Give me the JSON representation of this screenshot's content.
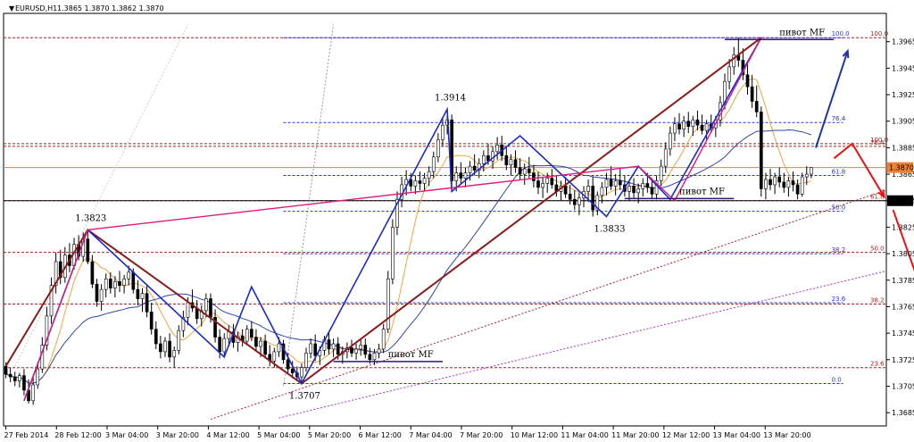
{
  "chart_data": {
    "type": "candlestick",
    "title": "EURUSD,H1  1.3865 1.3870 1.3862 1.3870",
    "symbol": "EURUSD,H1",
    "ohlc_header": "1.3865 1.3870 1.3862 1.3870",
    "ylim": [
      1.3675,
      1.3985
    ],
    "y_ticks": [
      "1.3965",
      "1.3945",
      "1.3925",
      "1.3905",
      "1.3885",
      "1.3865",
      "1.3845",
      "1.3825",
      "1.3805",
      "1.3785",
      "1.3765",
      "1.3745",
      "1.3725",
      "1.3705",
      "1.3685"
    ],
    "x_ticks": [
      "27 Feb 2014",
      "28 Feb 12:00",
      "3 Mar 04:00",
      "3 Mar 20:00",
      "4 Mar 12:00",
      "5 Mar 04:00",
      "5 Mar 20:00",
      "6 Mar 12:00",
      "7 Mar 04:00",
      "7 Mar 20:00",
      "10 Mar 12:00",
      "11 Mar 04:00",
      "11 Mar 20:00",
      "12 Mar 12:00",
      "13 Mar 04:00",
      "13 Mar 20:00"
    ],
    "current_price": {
      "value": 1.387,
      "label": "1.3870"
    },
    "marked_price": {
      "value": 1.3845,
      "label": "1.3845"
    },
    "swing_labels": [
      {
        "text": "1.3823",
        "price": 1.3823,
        "bar": 18
      },
      {
        "text": "1.3914",
        "price": 1.3914,
        "bar": 97
      },
      {
        "text": "1.3707",
        "price": 1.3707,
        "bar": 65
      },
      {
        "text": "1.3833",
        "price": 1.3833,
        "bar": 132
      }
    ],
    "pivot_labels": [
      {
        "text": "пивот MF",
        "price": 1.397,
        "bar": 170
      },
      {
        "text": "пивот MF",
        "price": 1.385,
        "bar": 148
      },
      {
        "text": "пивот MF",
        "price": 1.3727,
        "bar": 84
      }
    ],
    "fib_blue": [
      {
        "label": "100.0",
        "price": 1.3968
      },
      {
        "label": "76.4",
        "price": 1.3904
      },
      {
        "label": "61.8",
        "price": 1.3864
      },
      {
        "label": "50.0",
        "price": 1.3837
      },
      {
        "label": "38.2",
        "price": 1.3805
      },
      {
        "label": "23.6",
        "price": 1.3768
      },
      {
        "label": "0.0",
        "price": 1.3707
      }
    ],
    "fib_red": [
      {
        "label": "100.0",
        "price": 1.3968
      },
      {
        "label": "100.0",
        "price": 1.3888
      },
      {
        "label": "76.4",
        "price": 1.3886
      },
      {
        "label": "61.8",
        "price": 1.3845
      },
      {
        "label": "50.0",
        "price": 1.3806
      },
      {
        "label": "38.2",
        "price": 1.3767
      },
      {
        "label": "23.6",
        "price": 1.3719
      }
    ],
    "bars": [
      [
        1.372,
        1.3723,
        1.3711,
        1.3714
      ],
      [
        1.3714,
        1.3719,
        1.3708,
        1.3712
      ],
      [
        1.3712,
        1.3716,
        1.3705,
        1.3709
      ],
      [
        1.3709,
        1.3715,
        1.3704,
        1.3713
      ],
      [
        1.3713,
        1.3718,
        1.3698,
        1.3702
      ],
      [
        1.3702,
        1.371,
        1.3692,
        1.3694
      ],
      [
        1.3694,
        1.3712,
        1.3691,
        1.3706
      ],
      [
        1.3706,
        1.3723,
        1.3703,
        1.3718
      ],
      [
        1.3718,
        1.3742,
        1.3715,
        1.3736
      ],
      [
        1.3736,
        1.3765,
        1.3732,
        1.3758
      ],
      [
        1.3758,
        1.3787,
        1.3752,
        1.3781
      ],
      [
        1.3781,
        1.3806,
        1.3775,
        1.3799
      ],
      [
        1.3799,
        1.3808,
        1.3782,
        1.3787
      ],
      [
        1.3787,
        1.381,
        1.3783,
        1.3804
      ],
      [
        1.3804,
        1.3813,
        1.3791,
        1.3796
      ],
      [
        1.3796,
        1.3817,
        1.3793,
        1.3812
      ],
      [
        1.3812,
        1.3819,
        1.38,
        1.3803
      ],
      [
        1.3803,
        1.3821,
        1.3799,
        1.3816
      ],
      [
        1.3816,
        1.3823,
        1.3797,
        1.3799
      ],
      [
        1.3799,
        1.3804,
        1.3779,
        1.3782
      ],
      [
        1.3782,
        1.3786,
        1.3765,
        1.3769
      ],
      [
        1.3769,
        1.3782,
        1.3762,
        1.3778
      ],
      [
        1.3778,
        1.379,
        1.3772,
        1.3786
      ],
      [
        1.3786,
        1.3791,
        1.3775,
        1.3779
      ],
      [
        1.3779,
        1.3788,
        1.3772,
        1.3784
      ],
      [
        1.3784,
        1.3792,
        1.3776,
        1.3781
      ],
      [
        1.3781,
        1.3789,
        1.3775,
        1.3786
      ],
      [
        1.3786,
        1.3796,
        1.3781,
        1.3791
      ],
      [
        1.3791,
        1.3794,
        1.3775,
        1.3778
      ],
      [
        1.3778,
        1.3785,
        1.3766,
        1.3771
      ],
      [
        1.3771,
        1.3779,
        1.3761,
        1.3775
      ],
      [
        1.3775,
        1.3781,
        1.3757,
        1.3761
      ],
      [
        1.3761,
        1.3768,
        1.3744,
        1.3748
      ],
      [
        1.3748,
        1.3754,
        1.3733,
        1.3737
      ],
      [
        1.3737,
        1.3743,
        1.3726,
        1.3731
      ],
      [
        1.3731,
        1.3742,
        1.3727,
        1.3739
      ],
      [
        1.3739,
        1.3745,
        1.3723,
        1.3727
      ],
      [
        1.3727,
        1.3735,
        1.3719,
        1.3732
      ],
      [
        1.3732,
        1.3751,
        1.3729,
        1.3747
      ],
      [
        1.3747,
        1.3762,
        1.3742,
        1.3757
      ],
      [
        1.3757,
        1.3772,
        1.3751,
        1.3768
      ],
      [
        1.3768,
        1.3778,
        1.3761,
        1.3764
      ],
      [
        1.3764,
        1.377,
        1.3752,
        1.3756
      ],
      [
        1.3756,
        1.3766,
        1.375,
        1.3762
      ],
      [
        1.3762,
        1.3775,
        1.3757,
        1.3771
      ],
      [
        1.3771,
        1.3775,
        1.3753,
        1.3757
      ],
      [
        1.3757,
        1.3763,
        1.3738,
        1.3742
      ],
      [
        1.3742,
        1.3748,
        1.3726,
        1.3731
      ],
      [
        1.3731,
        1.3745,
        1.3727,
        1.3741
      ],
      [
        1.3741,
        1.3751,
        1.3735,
        1.3746
      ],
      [
        1.3746,
        1.3752,
        1.3734,
        1.3738
      ],
      [
        1.3738,
        1.3746,
        1.3731,
        1.3743
      ],
      [
        1.3743,
        1.3748,
        1.3735,
        1.3739
      ],
      [
        1.3739,
        1.3751,
        1.3736,
        1.3748
      ],
      [
        1.3748,
        1.3754,
        1.3739,
        1.3742
      ],
      [
        1.3742,
        1.3748,
        1.3731,
        1.3735
      ],
      [
        1.3735,
        1.3742,
        1.3727,
        1.3739
      ],
      [
        1.3739,
        1.3744,
        1.3726,
        1.3729
      ],
      [
        1.3729,
        1.3736,
        1.372,
        1.3724
      ],
      [
        1.3724,
        1.3734,
        1.3719,
        1.3731
      ],
      [
        1.3731,
        1.3742,
        1.3727,
        1.3737
      ],
      [
        1.3737,
        1.374,
        1.3722,
        1.3725
      ],
      [
        1.3725,
        1.373,
        1.3714,
        1.3718
      ],
      [
        1.3718,
        1.3724,
        1.3711,
        1.3715
      ],
      [
        1.3715,
        1.372,
        1.3709,
        1.3712
      ],
      [
        1.3712,
        1.3722,
        1.3707,
        1.3719
      ],
      [
        1.3719,
        1.3734,
        1.3716,
        1.373
      ],
      [
        1.373,
        1.3741,
        1.3726,
        1.3737
      ],
      [
        1.3737,
        1.3744,
        1.3724,
        1.3728
      ],
      [
        1.3728,
        1.3735,
        1.3721,
        1.3732
      ],
      [
        1.3732,
        1.3743,
        1.3728,
        1.374
      ],
      [
        1.374,
        1.3745,
        1.3729,
        1.3733
      ],
      [
        1.3733,
        1.3741,
        1.3727,
        1.3737
      ],
      [
        1.3737,
        1.3742,
        1.3725,
        1.3729
      ],
      [
        1.3729,
        1.3735,
        1.3722,
        1.3731
      ],
      [
        1.3731,
        1.3738,
        1.3726,
        1.3734
      ],
      [
        1.3734,
        1.374,
        1.3727,
        1.373
      ],
      [
        1.373,
        1.3737,
        1.3725,
        1.3733
      ],
      [
        1.3733,
        1.374,
        1.3728,
        1.3736
      ],
      [
        1.3736,
        1.3741,
        1.3726,
        1.3729
      ],
      [
        1.3729,
        1.3734,
        1.3722,
        1.3725
      ],
      [
        1.3725,
        1.3733,
        1.3721,
        1.373
      ],
      [
        1.373,
        1.3737,
        1.3726,
        1.3733
      ],
      [
        1.3733,
        1.3752,
        1.373,
        1.3748
      ],
      [
        1.3748,
        1.3792,
        1.3745,
        1.3786
      ],
      [
        1.3786,
        1.3831,
        1.3782,
        1.3825
      ],
      [
        1.3825,
        1.3852,
        1.3819,
        1.3846
      ],
      [
        1.3846,
        1.3863,
        1.384,
        1.3857
      ],
      [
        1.3857,
        1.3868,
        1.3849,
        1.3861
      ],
      [
        1.3861,
        1.3866,
        1.3852,
        1.3856
      ],
      [
        1.3856,
        1.3864,
        1.385,
        1.386
      ],
      [
        1.386,
        1.3867,
        1.3853,
        1.3858
      ],
      [
        1.3858,
        1.3866,
        1.3852,
        1.3862
      ],
      [
        1.3862,
        1.3871,
        1.3856,
        1.3867
      ],
      [
        1.3867,
        1.3882,
        1.3862,
        1.3878
      ],
      [
        1.3878,
        1.3896,
        1.3874,
        1.3891
      ],
      [
        1.3891,
        1.3908,
        1.3886,
        1.3902
      ],
      [
        1.3902,
        1.3914,
        1.3895,
        1.3906
      ],
      [
        1.3906,
        1.391,
        1.3855,
        1.386
      ],
      [
        1.386,
        1.3871,
        1.3852,
        1.3866
      ],
      [
        1.3866,
        1.3874,
        1.3858,
        1.3862
      ],
      [
        1.3862,
        1.387,
        1.3855,
        1.3866
      ],
      [
        1.3866,
        1.3875,
        1.386,
        1.3871
      ],
      [
        1.3871,
        1.388,
        1.3864,
        1.3868
      ],
      [
        1.3868,
        1.3877,
        1.3862,
        1.3873
      ],
      [
        1.3873,
        1.3883,
        1.3867,
        1.3879
      ],
      [
        1.3879,
        1.3888,
        1.3872,
        1.3875
      ],
      [
        1.3875,
        1.3886,
        1.3869,
        1.3882
      ],
      [
        1.3882,
        1.3893,
        1.3876,
        1.3887
      ],
      [
        1.3887,
        1.3894,
        1.3875,
        1.3879
      ],
      [
        1.3879,
        1.3886,
        1.3868,
        1.3872
      ],
      [
        1.3872,
        1.388,
        1.3864,
        1.3876
      ],
      [
        1.3876,
        1.3883,
        1.3866,
        1.387
      ],
      [
        1.387,
        1.3877,
        1.3861,
        1.3865
      ],
      [
        1.3865,
        1.3873,
        1.3857,
        1.3869
      ],
      [
        1.3869,
        1.3878,
        1.3862,
        1.3866
      ],
      [
        1.3866,
        1.3872,
        1.3855,
        1.386
      ],
      [
        1.386,
        1.3867,
        1.385,
        1.3855
      ],
      [
        1.3855,
        1.3863,
        1.3847,
        1.3858
      ],
      [
        1.3858,
        1.3866,
        1.3851,
        1.3862
      ],
      [
        1.3862,
        1.3869,
        1.3854,
        1.3857
      ],
      [
        1.3857,
        1.3864,
        1.3848,
        1.3852
      ],
      [
        1.3852,
        1.386,
        1.3845,
        1.3856
      ],
      [
        1.3856,
        1.3863,
        1.3847,
        1.385
      ],
      [
        1.385,
        1.3857,
        1.3842,
        1.3846
      ],
      [
        1.3846,
        1.3853,
        1.3838,
        1.3842
      ],
      [
        1.3842,
        1.3851,
        1.3834,
        1.3847
      ],
      [
        1.3847,
        1.3856,
        1.384,
        1.3852
      ],
      [
        1.3852,
        1.3861,
        1.3844,
        1.3856
      ],
      [
        1.3856,
        1.3863,
        1.3833,
        1.3838
      ],
      [
        1.3838,
        1.3852,
        1.3834,
        1.3849
      ],
      [
        1.3849,
        1.3859,
        1.3843,
        1.3855
      ],
      [
        1.3855,
        1.3866,
        1.3849,
        1.3861
      ],
      [
        1.3861,
        1.3871,
        1.3853,
        1.3856
      ],
      [
        1.3856,
        1.3865,
        1.3849,
        1.386
      ],
      [
        1.386,
        1.3869,
        1.3853,
        1.3857
      ],
      [
        1.3857,
        1.3864,
        1.3848,
        1.3852
      ],
      [
        1.3852,
        1.386,
        1.3845,
        1.3856
      ],
      [
        1.3856,
        1.3862,
        1.3847,
        1.3851
      ],
      [
        1.3851,
        1.3858,
        1.3843,
        1.3854
      ],
      [
        1.3854,
        1.3862,
        1.3848,
        1.3858
      ],
      [
        1.3858,
        1.3866,
        1.3851,
        1.3855
      ],
      [
        1.3855,
        1.3862,
        1.3847,
        1.385
      ],
      [
        1.385,
        1.3864,
        1.3846,
        1.386
      ],
      [
        1.386,
        1.3876,
        1.3856,
        1.3871
      ],
      [
        1.3871,
        1.3889,
        1.3866,
        1.3884
      ],
      [
        1.3884,
        1.3901,
        1.3879,
        1.3896
      ],
      [
        1.3896,
        1.3908,
        1.389,
        1.3903
      ],
      [
        1.3903,
        1.3911,
        1.3895,
        1.3899
      ],
      [
        1.3899,
        1.3909,
        1.3893,
        1.3905
      ],
      [
        1.3905,
        1.3912,
        1.3896,
        1.3901
      ],
      [
        1.3901,
        1.3909,
        1.3894,
        1.3906
      ],
      [
        1.3906,
        1.3913,
        1.3898,
        1.3902
      ],
      [
        1.3902,
        1.391,
        1.3895,
        1.3898
      ],
      [
        1.3898,
        1.3906,
        1.3891,
        1.3903
      ],
      [
        1.3903,
        1.391,
        1.3896,
        1.39
      ],
      [
        1.39,
        1.3909,
        1.3893,
        1.3906
      ],
      [
        1.3906,
        1.3924,
        1.3901,
        1.3919
      ],
      [
        1.3919,
        1.3941,
        1.3914,
        1.3935
      ],
      [
        1.3935,
        1.3952,
        1.3929,
        1.3946
      ],
      [
        1.3946,
        1.3961,
        1.394,
        1.3955
      ],
      [
        1.3955,
        1.3968,
        1.3946,
        1.3951
      ],
      [
        1.3951,
        1.396,
        1.3936,
        1.394
      ],
      [
        1.394,
        1.395,
        1.3925,
        1.3931
      ],
      [
        1.3931,
        1.394,
        1.3915,
        1.392
      ],
      [
        1.392,
        1.3932,
        1.3908,
        1.3912
      ],
      [
        1.3912,
        1.3916,
        1.3848,
        1.3854
      ],
      [
        1.3854,
        1.3866,
        1.3846,
        1.3861
      ],
      [
        1.3861,
        1.3869,
        1.3853,
        1.3857
      ],
      [
        1.3857,
        1.3866,
        1.385,
        1.3863
      ],
      [
        1.3863,
        1.387,
        1.3855,
        1.3859
      ],
      [
        1.3859,
        1.3866,
        1.3851,
        1.3855
      ],
      [
        1.3855,
        1.3863,
        1.3848,
        1.386
      ],
      [
        1.386,
        1.3867,
        1.3852,
        1.3857
      ],
      [
        1.3857,
        1.3861,
        1.3846,
        1.385
      ],
      [
        1.385,
        1.3866,
        1.3848,
        1.3863
      ],
      [
        1.3863,
        1.3871,
        1.3857,
        1.3865
      ],
      [
        1.3865,
        1.387,
        1.3862,
        1.387
      ]
    ],
    "zigzag_blue": [
      [
        4,
        1.3694
      ],
      [
        18,
        1.3823
      ],
      [
        48,
        1.3727
      ],
      [
        54,
        1.378
      ],
      [
        65,
        1.3707
      ],
      [
        97,
        1.3914
      ],
      [
        98,
        1.3852
      ],
      [
        113,
        1.3894
      ],
      [
        132,
        1.3833
      ],
      [
        139,
        1.3871
      ],
      [
        146,
        1.3846
      ],
      [
        166,
        1.3968
      ]
    ],
    "zigzag_darkred": [
      [
        0,
        1.372
      ],
      [
        18,
        1.3823
      ],
      [
        65,
        1.3707
      ],
      [
        166,
        1.3968
      ]
    ],
    "zigzag_pink": [
      [
        4,
        1.3694
      ],
      [
        18,
        1.3823
      ],
      [
        139,
        1.3871
      ],
      [
        147,
        1.3845
      ],
      [
        166,
        1.3968
      ]
    ],
    "forecast_arrows": [
      {
        "color": "#2233aa",
        "from": [
          178,
          1.3885
        ],
        "to": [
          185,
          1.3958
        ]
      },
      {
        "color": "#ee1111",
        "from": [
          182,
          1.3877
        ],
        "mid": [
          186,
          1.3888
        ],
        "to": [
          193,
          1.3848
        ]
      },
      {
        "color": "#ee1111",
        "from": [
          195,
          1.3838
        ],
        "to": [
          202,
          1.377
        ]
      }
    ],
    "colors": {
      "candle": "#000000",
      "ma_fast": "#f4a340",
      "ma_slow": "#3344aa",
      "fib_blue": "#2233ee",
      "fib_red": "#aa2222",
      "price_line": "#f08030",
      "trend_line_red": "#aa2233",
      "trend_line_purple": "#aa33cc"
    }
  }
}
